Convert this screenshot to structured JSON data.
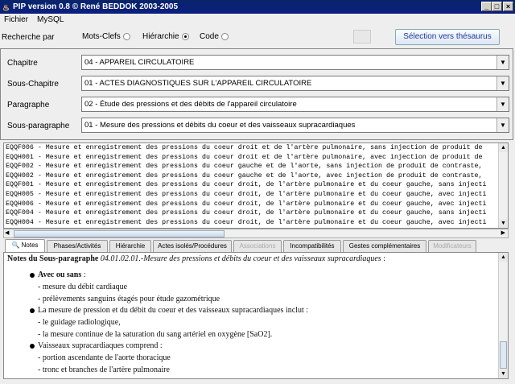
{
  "window": {
    "title": "PIP version 0.8 © René BEDDOK 2003-2005"
  },
  "menu": [
    "Fichier",
    "MySQL"
  ],
  "search": {
    "label": "Recherche par",
    "options": [
      {
        "label": "Mots-Clefs",
        "selected": false
      },
      {
        "label": "Hiérarchie",
        "selected": true
      },
      {
        "label": "Code",
        "selected": false
      }
    ],
    "button": "Sélection vers thésaurus"
  },
  "hierarchy": [
    {
      "label": "Chapitre",
      "value": "04 - APPAREIL CIRCULATOIRE"
    },
    {
      "label": "Sous-Chapitre",
      "value": "01 - ACTES DIAGNOSTIQUES SUR L'APPAREIL CIRCULATOIRE"
    },
    {
      "label": "Paragraphe",
      "value": "02 - Étude des pressions et des débits de l'appareil circulatoire"
    },
    {
      "label": "Sous-paragraphe",
      "value": "01 - Mesure des pressions et débits du coeur et des vaisseaux supracardiaques"
    }
  ],
  "acts": [
    "EQQF006 - Mesure et enregistrement des pressions du coeur droit et de l'artère pulmonaire, sans injection de produit de",
    "EQQH001 - Mesure et enregistrement des pressions du coeur droit et de l'artère pulmonaire, avec injection de produit de",
    "EQQF002 - Mesure et enregistrement des pressions du coeur gauche et de l'aorte, sans injection de produit de contraste,",
    "EQQH002 - Mesure et enregistrement des pressions du coeur gauche et de l'aorte, avec injection de produit de contraste,",
    "EQQF001 - Mesure et enregistrement des pressions du coeur droit, de l'artère pulmonaire et du coeur gauche, sans injecti",
    "EQQH005 - Mesure et enregistrement des pressions du coeur droit, de l'artère pulmonaire et du coeur gauche, avec injecti",
    "EQQH006 - Mesure et enregistrement des pressions du coeur droit, de l'artère pulmonaire et du coeur gauche, avec injecti",
    "EQQF004 - Mesure et enregistrement des pressions du coeur droit, de l'artère pulmonaire et du coeur gauche, sans injecti",
    "EQQH004 - Mesure et enregistrement des pressions du coeur droit, de l'artère pulmonaire et du coeur gauche, avec injecti"
  ],
  "tabs": [
    {
      "label": "Notes",
      "selected": true,
      "enabled": true,
      "icon": "magnifier-icon"
    },
    {
      "label": "Phases/Activités",
      "enabled": true
    },
    {
      "label": "Hiérarchie",
      "enabled": true
    },
    {
      "label": "Actes isolés/Procédures",
      "enabled": true
    },
    {
      "label": "Associations",
      "enabled": false
    },
    {
      "label": "Incompatibilités",
      "enabled": true
    },
    {
      "label": "Gestes complémentaires",
      "enabled": true
    },
    {
      "label": "Modificateurs",
      "enabled": false
    }
  ],
  "notes": {
    "heading": "Notes du Sous-paragraphe",
    "heading_ref": "04.01.02.01.-Mesure des pressions et débits du coeur et des vaisseaux supracardiaques",
    "heading_end": " :",
    "b1": "Avec ou sans",
    "b1_end": " :",
    "b1_items": [
      "- mesure du débit cardiaque",
      "- prélèvements sanguins étagés pour étude gazométrique"
    ],
    "b2": "La mesure de pression et du débit du coeur et des vaisseaux supracardiaques inclut :",
    "b2_items": [
      "- le guidage radiologique,",
      "- la mesure continue de la saturation du sang artériel en oxygène [SaO2]."
    ],
    "b3": "Vaisseaux supracardiaques comprend :",
    "b3_items": [
      "- portion ascendante de l'aorte thoracique",
      "- tronc et branches de l'artère pulmonaire"
    ]
  }
}
